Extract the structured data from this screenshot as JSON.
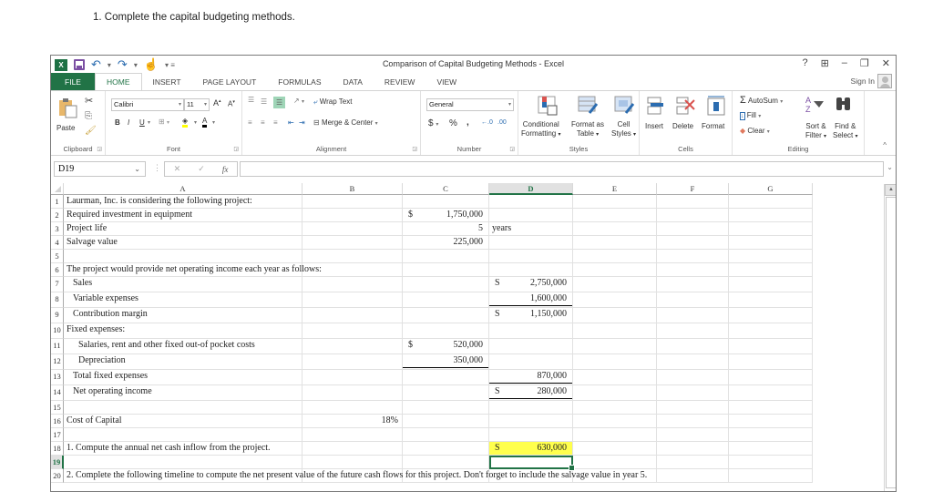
{
  "instruction": "1. Complete the capital budgeting methods.",
  "window": {
    "title": "Comparison of Capital Budgeting Methods - Excel",
    "controls": [
      "?",
      "⊞",
      "–",
      "❐",
      "✕"
    ],
    "sign_in": "Sign In"
  },
  "tabs": [
    "FILE",
    "HOME",
    "INSERT",
    "PAGE LAYOUT",
    "FORMULAS",
    "DATA",
    "REVIEW",
    "VIEW"
  ],
  "ribbon": {
    "clipboard": {
      "label": "Clipboard",
      "paste": "Paste"
    },
    "font": {
      "label": "Font",
      "name": "Calibri",
      "size": "11",
      "bold": "B",
      "italic": "I",
      "underline": "U"
    },
    "alignment": {
      "label": "Alignment",
      "wrap_text": "Wrap Text",
      "merge_center": "Merge & Center"
    },
    "number": {
      "label": "Number",
      "format": "General",
      "currency": "$",
      "percent": "%",
      "comma": ","
    },
    "styles": {
      "label": "Styles",
      "conditional_1": "Conditional",
      "conditional_2": "Formatting",
      "format_table_1": "Format as",
      "format_table_2": "Table",
      "cell_styles_1": "Cell",
      "cell_styles_2": "Styles"
    },
    "cells": {
      "label": "Cells",
      "insert": "Insert",
      "delete": "Delete",
      "format": "Format"
    },
    "editing": {
      "label": "Editing",
      "autosum": "AutoSum",
      "fill": "Fill",
      "clear": "Clear",
      "sort_1": "Sort &",
      "sort_2": "Filter",
      "find_1": "Find &",
      "find_2": "Select"
    }
  },
  "formula_bar": {
    "name_box": "D19",
    "formula": ""
  },
  "columns": [
    "A",
    "B",
    "C",
    "D",
    "E",
    "F",
    "G"
  ],
  "selected_column": "D",
  "selected_row": "19",
  "rows": [
    {
      "n": "1",
      "A": "Laurman, Inc. is considering the following project:"
    },
    {
      "n": "2",
      "A": "Required investment in equipment",
      "C_sym": "$",
      "C": "1,750,000"
    },
    {
      "n": "3",
      "A": "Project life",
      "C": "5",
      "D_text": "years"
    },
    {
      "n": "4",
      "A": "Salvage value",
      "C": "225,000"
    },
    {
      "n": "5"
    },
    {
      "n": "6",
      "A": "The project would provide net operating income each year as follows:"
    },
    {
      "n": "7",
      "A": "Sales",
      "D_sym": "S",
      "D": "2,750,000"
    },
    {
      "n": "8",
      "A": "Variable expenses",
      "D": "1,600,000"
    },
    {
      "n": "9",
      "A": "Contribution margin",
      "D_sym": "S",
      "D": "1,150,000"
    },
    {
      "n": "10",
      "A": "Fixed expenses:"
    },
    {
      "n": "11",
      "A": "Salaries, rent and other fixed out-of pocket costs",
      "C_sym": "$",
      "C": "520,000"
    },
    {
      "n": "12",
      "A": "Depreciation",
      "C": "350,000"
    },
    {
      "n": "13",
      "A": "Total fixed expenses",
      "D": "870,000"
    },
    {
      "n": "14",
      "A": "Net operating income",
      "D_sym": "S",
      "D": "280,000"
    },
    {
      "n": "15"
    },
    {
      "n": "16",
      "A": "Cost of Capital",
      "B": "18%"
    },
    {
      "n": "17"
    },
    {
      "n": "18",
      "A": "1. Compute the annual net cash inflow from the project.",
      "D_sym": "S",
      "D": "630,000"
    },
    {
      "n": "19"
    },
    {
      "n": "20",
      "A": "2.  Complete the following timeline to compute the net present value of the future cash flows for this project.  Don't forget to include the salvage value in year 5."
    }
  ],
  "colors": {
    "excel_green": "#217346",
    "highlight_yellow": "#ffff4d"
  }
}
